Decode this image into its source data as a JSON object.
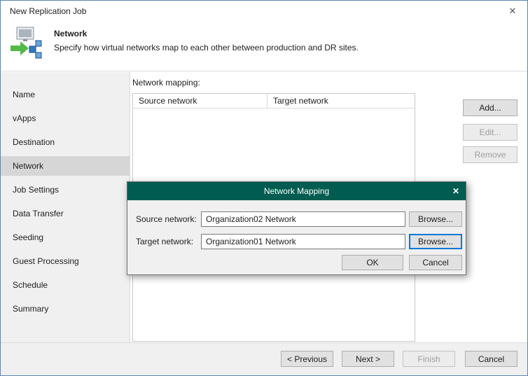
{
  "window": {
    "title": "New Replication Job",
    "close_label": "✕"
  },
  "header": {
    "title": "Network",
    "description": "Specify how virtual networks map to each other between production and DR sites."
  },
  "sidebar": {
    "items": [
      {
        "label": "Name"
      },
      {
        "label": "vApps"
      },
      {
        "label": "Destination"
      },
      {
        "label": "Network",
        "active": true
      },
      {
        "label": "Job Settings"
      },
      {
        "label": "Data Transfer"
      },
      {
        "label": "Seeding"
      },
      {
        "label": "Guest Processing"
      },
      {
        "label": "Schedule"
      },
      {
        "label": "Summary"
      }
    ]
  },
  "main": {
    "mapping_label": "Network mapping:",
    "table": {
      "columns": [
        "Source network",
        "Target network"
      ],
      "rows": []
    },
    "side_buttons": {
      "add": "Add...",
      "edit": "Edit...",
      "remove": "Remove"
    }
  },
  "modal": {
    "title": "Network Mapping",
    "close_label": "✕",
    "source": {
      "label": "Source network:",
      "value": "Organization02 Network",
      "browse": "Browse..."
    },
    "target": {
      "label": "Target network:",
      "value": "Organization01 Network",
      "browse": "Browse..."
    },
    "ok": "OK",
    "cancel": "Cancel"
  },
  "footer": {
    "previous": "< Previous",
    "next": "Next >",
    "finish": "Finish",
    "cancel": "Cancel"
  },
  "colors": {
    "modal_header": "#005c50",
    "focus_blue": "#0078d7",
    "arrow_green": "#54b948",
    "node_blue": "#2f7ac3"
  }
}
